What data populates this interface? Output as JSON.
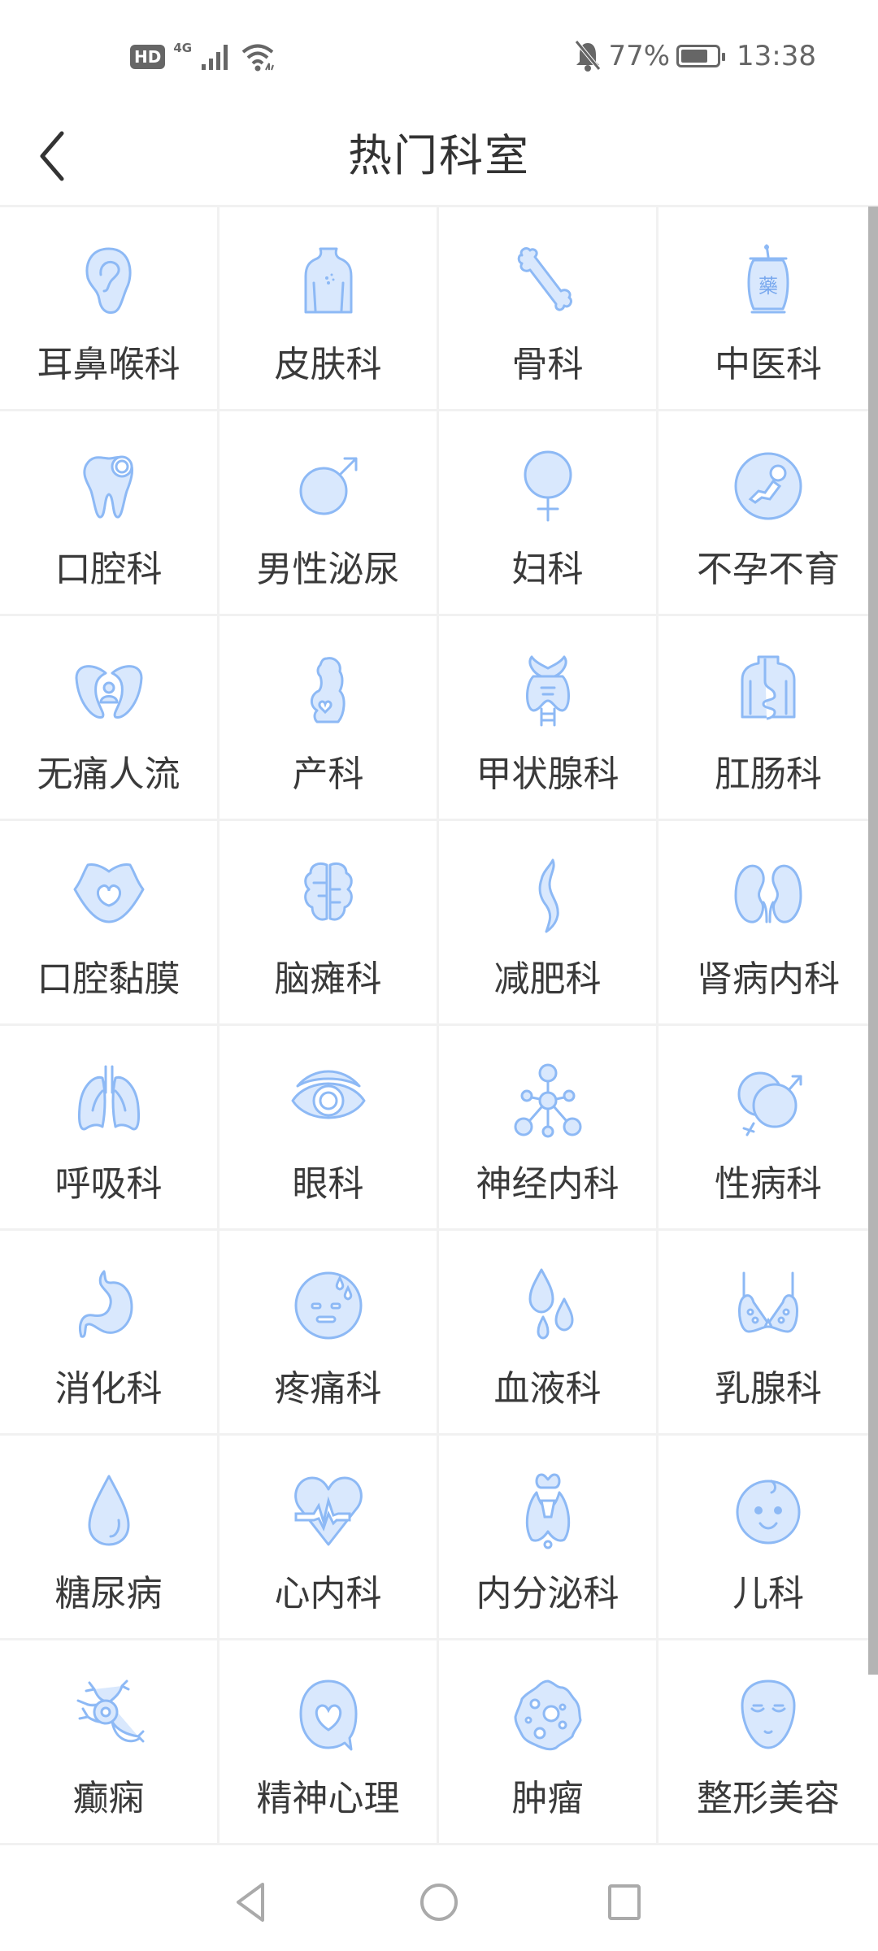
{
  "status_bar": {
    "hd_badge": "HD",
    "network_type": "4G",
    "battery_percent": "77%",
    "battery_level": 0.77,
    "time": "13:38",
    "icons": [
      "hd-icon",
      "signal-icon",
      "wifi-icon",
      "mute-bell-icon",
      "battery-icon"
    ]
  },
  "header": {
    "title": "热门科室",
    "back_icon": "chevron-left-icon"
  },
  "theme": {
    "icon_fill": "#d9e8fd",
    "icon_stroke": "#8db9f5",
    "text": "#3a3a3a",
    "divider": "#f1f1f1",
    "scrollbar": "#b4b4b4"
  },
  "departments": [
    {
      "label": "耳鼻喉科",
      "icon": "ear-icon"
    },
    {
      "label": "皮肤科",
      "icon": "skin-back-icon"
    },
    {
      "label": "骨科",
      "icon": "bone-icon"
    },
    {
      "label": "中医科",
      "icon": "medicine-jar-icon"
    },
    {
      "label": "口腔科",
      "icon": "tooth-icon"
    },
    {
      "label": "男性泌尿",
      "icon": "male-symbol-icon"
    },
    {
      "label": "妇科",
      "icon": "female-symbol-icon"
    },
    {
      "label": "不孕不育",
      "icon": "fetus-icon"
    },
    {
      "label": "无痛人流",
      "icon": "hands-protect-icon"
    },
    {
      "label": "产科",
      "icon": "pregnant-woman-icon"
    },
    {
      "label": "甲状腺科",
      "icon": "thyroid-icon"
    },
    {
      "label": "肛肠科",
      "icon": "intestine-icon"
    },
    {
      "label": "口腔黏膜",
      "icon": "lips-icon"
    },
    {
      "label": "脑瘫科",
      "icon": "brain-icon"
    },
    {
      "label": "减肥科",
      "icon": "slim-body-icon"
    },
    {
      "label": "肾病内科",
      "icon": "kidney-icon"
    },
    {
      "label": "呼吸科",
      "icon": "lungs-icon"
    },
    {
      "label": "眼科",
      "icon": "eye-icon"
    },
    {
      "label": "神经内科",
      "icon": "neuron-network-icon"
    },
    {
      "label": "性病科",
      "icon": "gender-symbols-icon"
    },
    {
      "label": "消化科",
      "icon": "stomach-icon"
    },
    {
      "label": "疼痛科",
      "icon": "pain-face-icon"
    },
    {
      "label": "血液科",
      "icon": "blood-drops-icon"
    },
    {
      "label": "乳腺科",
      "icon": "bra-icon"
    },
    {
      "label": "糖尿病",
      "icon": "drop-icon"
    },
    {
      "label": "心内科",
      "icon": "heart-pulse-icon"
    },
    {
      "label": "内分泌科",
      "icon": "endocrine-icon"
    },
    {
      "label": "儿科",
      "icon": "baby-face-icon"
    },
    {
      "label": "癫痫",
      "icon": "nerve-cell-icon"
    },
    {
      "label": "精神心理",
      "icon": "heart-bubble-icon"
    },
    {
      "label": "肿瘤",
      "icon": "tumor-cell-icon"
    },
    {
      "label": "整形美容",
      "icon": "face-mask-icon"
    }
  ],
  "nav_bar": {
    "buttons": [
      "back-triangle-icon",
      "home-circle-icon",
      "recents-square-icon"
    ]
  }
}
